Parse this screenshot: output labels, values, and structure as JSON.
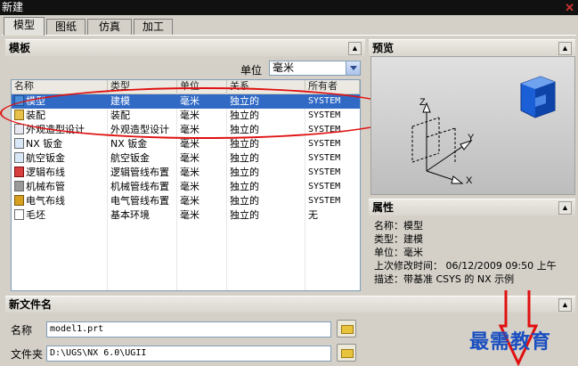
{
  "window": {
    "title": "新建",
    "close_icon": "close-icon"
  },
  "tabs": [
    {
      "label": "模型",
      "active": true
    },
    {
      "label": "图纸",
      "active": false
    },
    {
      "label": "仿真",
      "active": false
    },
    {
      "label": "加工",
      "active": false
    }
  ],
  "templates": {
    "header": "模板",
    "unit_label": "单位",
    "unit_value": "毫米",
    "columns": [
      "名称",
      "类型",
      "单位",
      "关系",
      "所有者"
    ],
    "rows": [
      {
        "icon": "model-icon",
        "name": "模型",
        "type": "建模",
        "unit": "毫米",
        "rel": "独立的",
        "owner": "SYSTEM",
        "selected": true
      },
      {
        "icon": "assembly-icon",
        "name": "装配",
        "type": "装配",
        "unit": "毫米",
        "rel": "独立的",
        "owner": "SYSTEM",
        "selected": false
      },
      {
        "icon": "shape-studio-icon",
        "name": "外观造型设计",
        "type": "外观造型设计",
        "unit": "毫米",
        "rel": "独立的",
        "owner": "SYSTEM",
        "selected": false
      },
      {
        "icon": "sheet-metal-icon",
        "name": "NX 钣金",
        "type": "NX 钣金",
        "unit": "毫米",
        "rel": "独立的",
        "owner": "SYSTEM",
        "selected": false
      },
      {
        "icon": "aero-sheet-metal-icon",
        "name": "航空钣金",
        "type": "航空钣金",
        "unit": "毫米",
        "rel": "独立的",
        "owner": "SYSTEM",
        "selected": false
      },
      {
        "icon": "logic-routing-icon",
        "name": "逻辑布线",
        "type": "逻辑管线布置",
        "unit": "毫米",
        "rel": "独立的",
        "owner": "SYSTEM",
        "selected": false
      },
      {
        "icon": "mech-routing-icon",
        "name": "机械布管",
        "type": "机械管线布置",
        "unit": "毫米",
        "rel": "独立的",
        "owner": "SYSTEM",
        "selected": false
      },
      {
        "icon": "elec-routing-icon",
        "name": "电气布线",
        "type": "电气管线布置",
        "unit": "毫米",
        "rel": "独立的",
        "owner": "SYSTEM",
        "selected": false
      },
      {
        "icon": "blank-icon",
        "name": "毛坯",
        "type": "基本环境",
        "unit": "毫米",
        "rel": "独立的",
        "owner": "无",
        "selected": false
      }
    ]
  },
  "preview": {
    "header": "预览",
    "axis_z": "Z",
    "axis_y": "Y",
    "axis_x": "X"
  },
  "properties": {
    "header": "属性",
    "name": "名称：模型",
    "type": "类型：建模",
    "unit": "单位：毫米",
    "modified": "上次修改时间：  06/12/2009 09:50 上午",
    "desc": "描述：带基准 CSYS 的 NX 示例"
  },
  "new_file": {
    "header": "新文件名",
    "name_label": "名称",
    "name_value": "model1.prt",
    "folder_label": "文件夹",
    "folder_value": "D:\\UGS\\NX 6.0\\UGII"
  },
  "watermark": "最需教育",
  "colors": {
    "selection": "#316ac5",
    "annotation": "#e01010",
    "watermark": "#1a4fc0"
  }
}
